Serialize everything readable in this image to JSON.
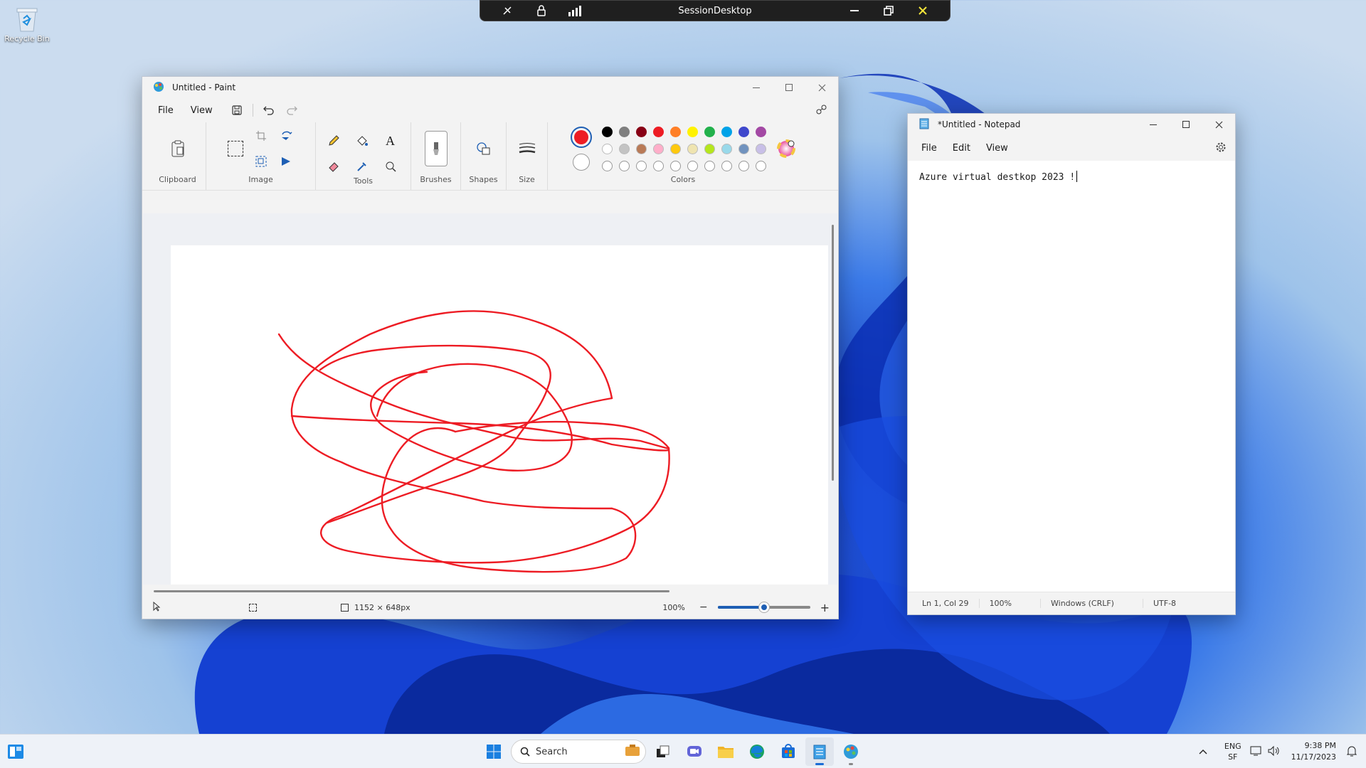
{
  "desktop": {
    "recycle_bin_label": "Recycle Bin"
  },
  "session_bar": {
    "title": "SessionDesktop"
  },
  "paint": {
    "title": "Untitled - Paint",
    "menu": {
      "file": "File",
      "view": "View"
    },
    "groups": {
      "clipboard": "Clipboard",
      "image": "Image",
      "tools": "Tools",
      "brushes": "Brushes",
      "shapes": "Shapes",
      "size": "Size",
      "colors": "Colors"
    },
    "primary_color": "#ed1c24",
    "secondary_color": "#ffffff",
    "palette_row1": [
      "#000000",
      "#7f7f7f",
      "#880015",
      "#ed1c24",
      "#ff7f27",
      "#fff200",
      "#22b14c",
      "#00a2e8",
      "#3f48cc",
      "#a349a4"
    ],
    "palette_row2": [
      "#ffffff",
      "#c3c3c3",
      "#b97a57",
      "#ffaec9",
      "#ffc90e",
      "#efe4b0",
      "#b5e61d",
      "#99d9ea",
      "#7092be",
      "#c8bfe7"
    ],
    "palette_row3_count": 10,
    "status": {
      "dimensions": "1152 × 648px",
      "zoom": "100%",
      "zoom_level": 0.5
    }
  },
  "notepad": {
    "title": "*Untitled - Notepad",
    "menu": {
      "file": "File",
      "edit": "Edit",
      "view": "View"
    },
    "content": "Azure virtual destkop 2023 !",
    "status": {
      "position": "Ln 1, Col 29",
      "zoom": "100%",
      "line_ending": "Windows (CRLF)",
      "encoding": "UTF-8"
    }
  },
  "taskbar": {
    "search_placeholder": "Search",
    "lang_top": "ENG",
    "lang_bottom": "SF",
    "time": "9:38 PM",
    "date": "11/17/2023"
  }
}
